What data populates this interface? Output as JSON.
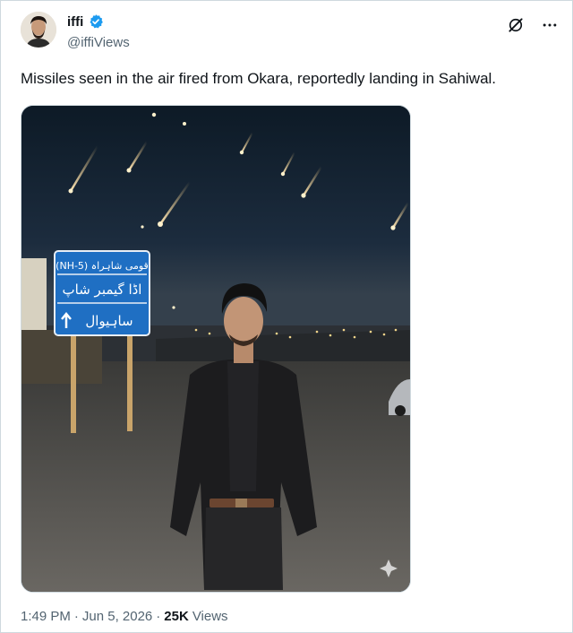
{
  "author": {
    "display_name": "iffi",
    "handle": "@iffiViews",
    "verified": true
  },
  "tweet": {
    "text": "Missiles seen in the air fired from Okara, reportedly landing in Sahiwal."
  },
  "sign": {
    "line1": "(NH-5) قومی شاہراہ",
    "line2": "اڈا گیمبر شاپ",
    "line3": "ساہیوال"
  },
  "meta": {
    "time": "1:49 PM",
    "sep1": "·",
    "date": "Jun 5, 2026",
    "sep2": "·",
    "views_count": "25K",
    "views_label": "Views"
  },
  "icons": {
    "verified": "verified-badge-icon",
    "grok": "grok-icon",
    "more": "more-icon",
    "sparkle": "sparkle-icon"
  },
  "colors": {
    "accent": "#1d9bf0",
    "secondary_text": "#536471",
    "sign_blue": "#1f6fc3"
  }
}
